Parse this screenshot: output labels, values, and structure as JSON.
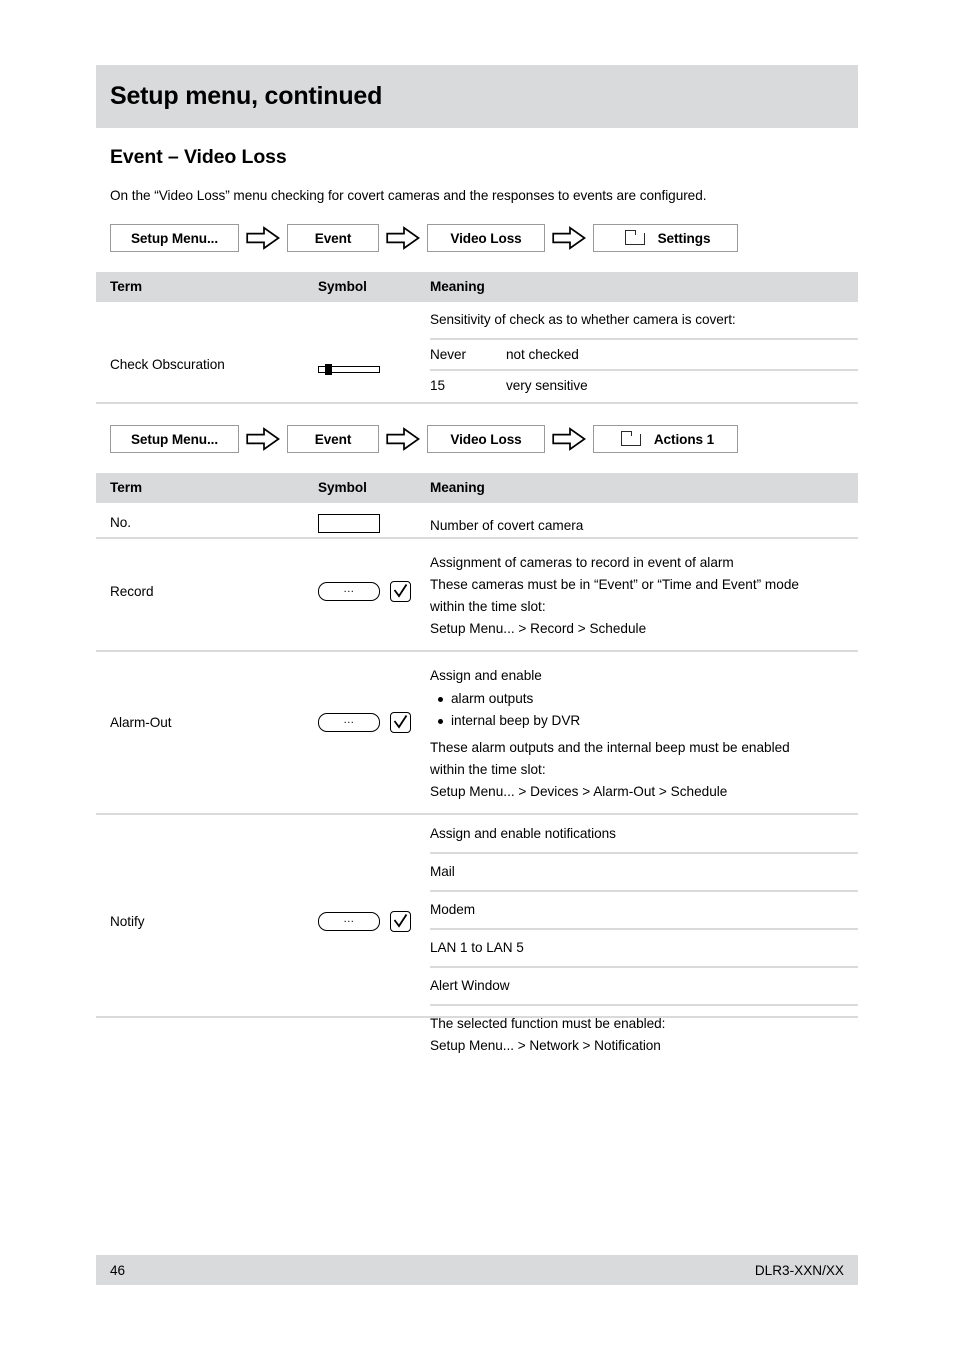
{
  "header": {
    "title": "Setup menu, continued"
  },
  "section": {
    "heading": "Event – Video Loss",
    "intro": "On the “Video Loss” menu checking for covert cameras and the responses to events are configured."
  },
  "breadcrumbs": [
    {
      "c1": "Setup Menu...",
      "c2": "Event",
      "c3": "Video Loss",
      "c4": "Settings"
    },
    {
      "c1": "Setup Menu...",
      "c2": "Event",
      "c3": "Video Loss",
      "c4": "Actions 1"
    }
  ],
  "table_headers": {
    "term": "Term",
    "symbol": "Symbol",
    "meaning": "Meaning"
  },
  "table1": {
    "rows": [
      {
        "term": "Check Obscuration",
        "symbol": "slider-icon",
        "symbol_ellipsis": "",
        "lines": [
          {
            "text": "Sensitivity of check as to whether camera is covert:"
          },
          {
            "key": "Never",
            "value": "not checked"
          },
          {
            "key": "15",
            "value": "very sensitive"
          }
        ]
      }
    ]
  },
  "table2": {
    "rows": [
      {
        "term": "No.",
        "symbol": "text-field-icon",
        "lines": [
          {
            "text": "Number of covert camera"
          }
        ]
      },
      {
        "term": "Record",
        "symbol": "ellipsis-button-and-checkbox-icon",
        "symbol_ellipsis": "...",
        "lines": [
          {
            "text": "Assignment of cameras to record in event of alarm"
          },
          {
            "text": "These cameras must be in “Event” or “Time and Event” mode"
          },
          {
            "text": "within the time slot:"
          },
          {
            "text": "Setup Menu... > Record > Schedule"
          }
        ]
      },
      {
        "term": "Alarm-Out",
        "symbol": "ellipsis-button-and-checkbox-icon",
        "symbol_ellipsis": "...",
        "lines": [
          {
            "text": "Assign and enable"
          }
        ],
        "bullets": [
          "alarm outputs",
          "internal beep by DVR"
        ],
        "lines_after": [
          {
            "text": "These alarm outputs and the internal beep must be enabled"
          },
          {
            "text": "within the time slot:"
          },
          {
            "text": "Setup Menu... > Devices > Alarm-Out > Schedule"
          }
        ]
      },
      {
        "term": "Notify",
        "symbol": "ellipsis-button-and-checkbox-icon",
        "symbol_ellipsis": "...",
        "sub_rows": [
          "Assign and enable notifications",
          "Mail",
          "Modem",
          "LAN 1 to LAN 5",
          "Alert Window"
        ],
        "tail_lines": [
          "The selected function must be enabled:",
          "Setup Menu... > Network > Notification"
        ]
      }
    ]
  },
  "footer": {
    "page_number": "46",
    "model": "DLR3-XXN/XX"
  },
  "colors": {
    "band_gray": "#d9dadc",
    "divider_gray": "#d9dadc",
    "text": "#000000"
  }
}
